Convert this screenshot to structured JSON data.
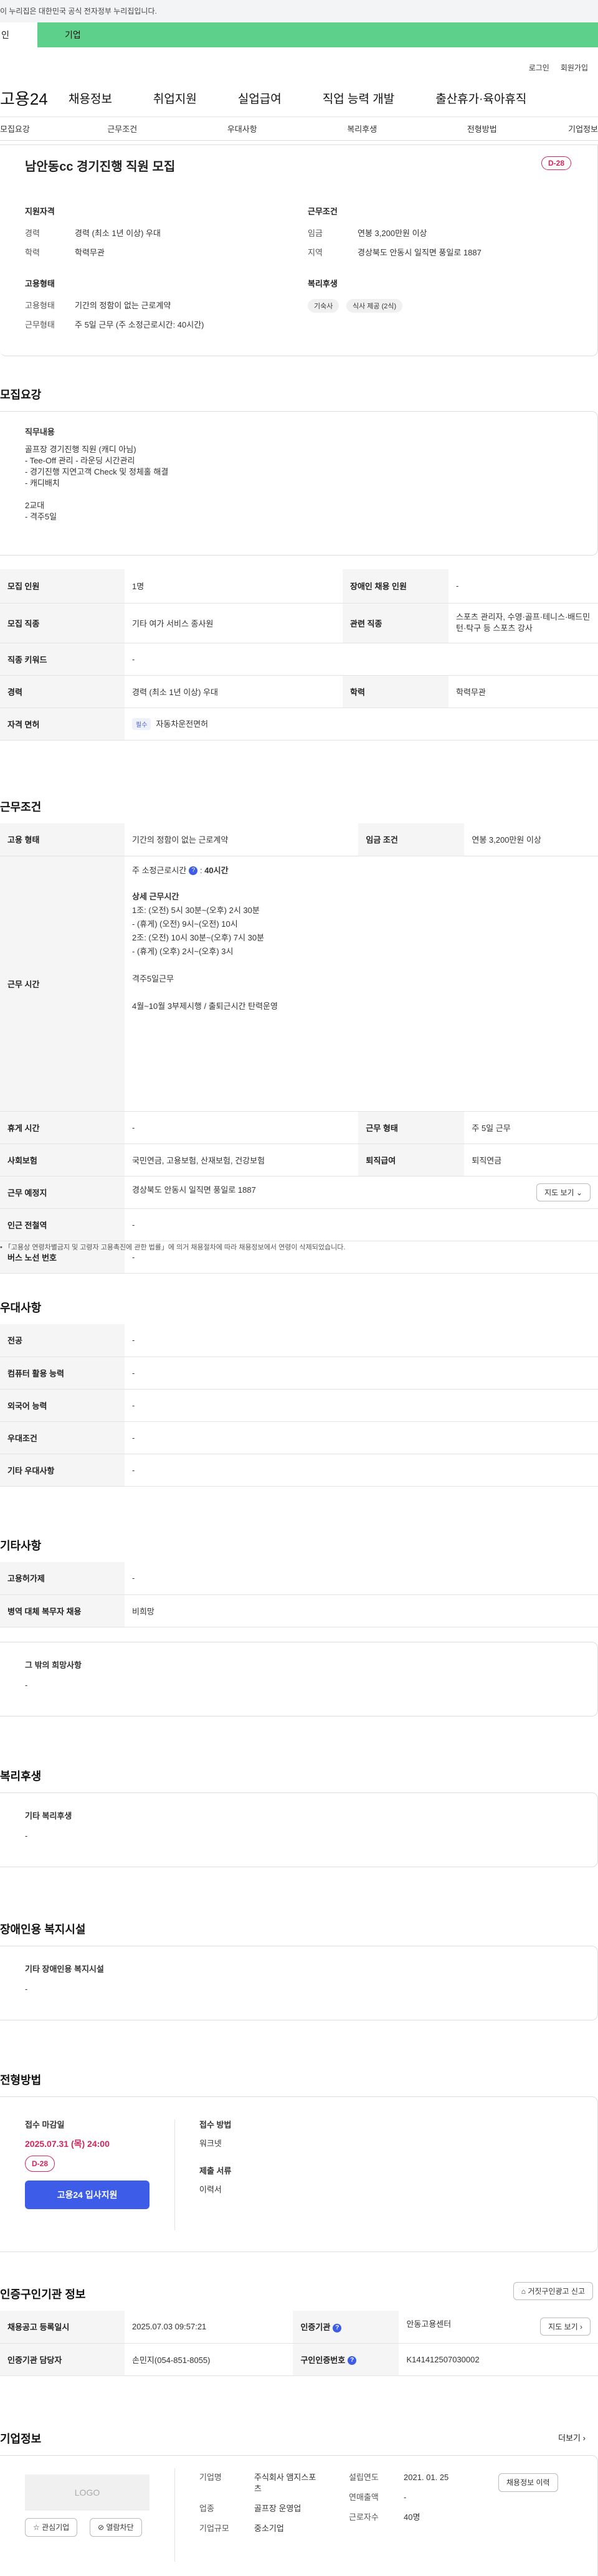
{
  "notice": "이 누리집은 대한민국 공식 전자정부 누리집입니다.",
  "orgbar": {
    "left": "인",
    "right": "기업"
  },
  "util": {
    "login": "로그인",
    "join": "회원가입"
  },
  "gnb": {
    "logo": "고용24",
    "menu": [
      "채용정보",
      "취업지원",
      "실업급여",
      "직업 능력 개발",
      "출산휴가·육아휴직"
    ]
  },
  "tabs": [
    "모집요강",
    "근무조건",
    "우대사항",
    "복리후생",
    "전형방법",
    "기업정보"
  ],
  "summary": {
    "title": "남안동cc 경기진행 직원 모집",
    "dday": "D-28",
    "qual": {
      "heading": "지원자격",
      "rows": [
        [
          "경력",
          "경력 (최소 1년 이상) 우대"
        ],
        [
          "학력",
          "학력무관"
        ]
      ]
    },
    "cond": {
      "heading": "근무조건",
      "rows": [
        [
          "임금",
          "연봉 3,200만원 이상"
        ],
        [
          "지역",
          "경상북도 안동시 일직면 풍일로 1887"
        ]
      ]
    },
    "emp": {
      "heading": "고용형태",
      "rows": [
        [
          "고용형태",
          "기간의 정함이 없는 근로계약"
        ],
        [
          "근무형태",
          "주 5일 근무 (주 소정근로시간: 40시간)"
        ]
      ]
    },
    "welfare": {
      "heading": "복리후생",
      "chips": [
        "기숙사",
        "식사 제공 (2식)"
      ]
    }
  },
  "recruit": {
    "heading": "모집요강",
    "job_title": "직무내용",
    "job_lines": [
      "골프장 경기진행 직원 (캐디 아님)",
      "- Tee-Off 관리 - 라운딩 시간관리",
      "- 경기진행 지연고객 Check 및 정체홀 해결",
      "- 캐디배치",
      "",
      "2교대",
      "- 격주5일"
    ],
    "rows": {
      "count_k": "모집 인원",
      "count_v": "1명",
      "dis_k": "장애인 채용 인원",
      "dis_v": "-",
      "job_k": "모집 직종",
      "job_v": "기타 여가 서비스 종사원",
      "rel_k": "관련 직종",
      "rel_v": "스포츠 관리자, 수영·골프·테니스·배드민턴·탁구 등 스포츠 강사",
      "kw_k": "직종 키워드",
      "kw_v": "-",
      "car_k": "경력",
      "car_v": "경력 (최소 1년 이상) 우대",
      "edu_k": "학력",
      "edu_v": "학력무관",
      "lic_k": "자격 면허",
      "lic_tag": "필수",
      "lic_v": "자동차운전면허"
    }
  },
  "work": {
    "heading": "근무조건",
    "type_k": "고용 형태",
    "type_v": "기간의 정함이 없는 근로계약",
    "wage_k": "임금 조건",
    "wage_v": "연봉 3,200만원 이상",
    "time_k": "근무 시간",
    "time_main": "주 소정근로시간",
    "time_hours": "40시간",
    "time_lines": [
      "상세 근무시간",
      "1조: (오전) 5시 30분~(오후) 2시 30분",
      "- (휴게) (오전) 9시~(오전) 10시",
      "2조: (오전) 10시 30분~(오후) 7시 30분",
      "- (휴게) (오후) 2시~(오후) 3시",
      "",
      "격주5일근무",
      "",
      "4월~10월 3부제시행 / 출퇴근시간 탄력운영"
    ],
    "rest_k": "휴게 시간",
    "rest_v": "-",
    "form_k": "근무 형태",
    "form_v": "주 5일 근무",
    "ins_k": "사회보험",
    "ins_v": "국민연금, 고용보험, 산재보험, 건강보험",
    "ret_k": "퇴직급여",
    "ret_v": "퇴직연금",
    "place_k": "근무 예정지",
    "place_v": "경상북도 안동시 일직면 풍일로 1887",
    "map_btn": "지도 보기",
    "sub_k": "인근 전철역",
    "sub_v": "-",
    "bus_k": "버스 노선 번호",
    "bus_v": "-",
    "note": "「고용상 연령차별금지 및 고령자 고용촉진에 관한 법률」에 의거 채용절차에 따라 채용정보에서 연령이 삭제되었습니다."
  },
  "prefer": {
    "heading": "우대사항",
    "rows": [
      [
        "전공",
        "-"
      ],
      [
        "컴퓨터 활용 능력",
        "-"
      ],
      [
        "외국어 능력",
        "-"
      ],
      [
        "우대조건",
        "-"
      ],
      [
        "기타 우대사항",
        "-"
      ]
    ]
  },
  "other": {
    "heading": "기타사항",
    "rows": [
      [
        "고용허가제",
        "-"
      ],
      [
        "병역 대체 복무자 채용",
        "비희망"
      ]
    ],
    "etc_title": "그 밖의 희망사항",
    "etc_v": "-"
  },
  "welfare": {
    "heading": "복리후생",
    "title": "기타 복리후생",
    "v": "-"
  },
  "disfac": {
    "heading": "장애인용 복지시설",
    "title": "기타 장애인용 복지시설",
    "v": "-"
  },
  "process": {
    "heading": "전형방법",
    "deadline_k": "접수 마감일",
    "deadline_v": "2025.07.31 (목) 24:00",
    "dday": "D-28",
    "apply_btn": "고용24 입사지원",
    "method_k": "접수 방법",
    "method_v": "워크넷",
    "docs_k": "제출 서류",
    "docs_v": "이력서"
  },
  "cert": {
    "heading": "인증구인기관 정보",
    "report_btn": "거짓구인광고 신고",
    "reg_k": "채용공고 등록일시",
    "reg_v": "2025.07.03 09:57:21",
    "org_k": "인증기관",
    "org_v": "안동고용센터",
    "map_btn": "지도 보기",
    "mgr_k": "인증기관 담당자",
    "mgr_v": "손민지(054-851-8055)",
    "no_k": "구인인증번호",
    "no_v": "K141412507030002"
  },
  "company": {
    "heading": "기업정보",
    "more": "더보기",
    "logo": "LOGO",
    "fav_btn": "관심기업",
    "hide_btn": "열람차단",
    "name_k": "기업명",
    "name_v": "주식회사 앰지스포츠",
    "ind_k": "업종",
    "ind_v": "골프장 운영업",
    "size_k": "기업규모",
    "size_v": "중소기업",
    "est_k": "설립연도",
    "est_v": "2021. 01. 25",
    "sales_k": "연매출액",
    "sales_v": "-",
    "emp_k": "근로자수",
    "emp_v": "40명",
    "jobs_btn": "채용정보 이력"
  }
}
